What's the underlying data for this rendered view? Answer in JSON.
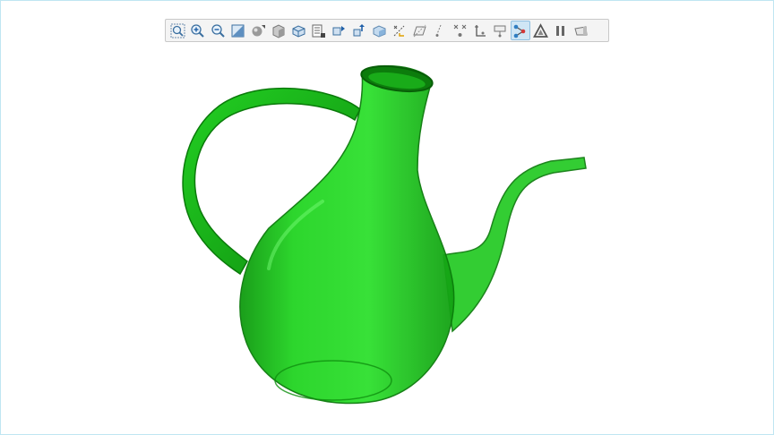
{
  "viewer": {
    "background_color": "#ffffff",
    "border_color": "#bfe6f2",
    "model_color": "#1ecc1e"
  },
  "toolbar": {
    "tools": [
      {
        "icon": "zoom-fit-icon",
        "active": false
      },
      {
        "icon": "zoom-in-icon",
        "active": false
      },
      {
        "icon": "zoom-out-icon",
        "active": false
      },
      {
        "icon": "section-plane-icon",
        "active": false
      },
      {
        "icon": "shading-icon",
        "active": false
      },
      {
        "icon": "box-view-icon",
        "active": false
      },
      {
        "icon": "named-views-icon",
        "active": false
      },
      {
        "icon": "model-tree-icon",
        "active": false
      },
      {
        "icon": "move-part-icon",
        "active": false
      },
      {
        "icon": "explode-icon",
        "active": false
      },
      {
        "icon": "transparency-icon",
        "active": false
      },
      {
        "icon": "measure-distance-icon",
        "active": false
      },
      {
        "icon": "measure-plane-icon",
        "active": false
      },
      {
        "icon": "measure-line-icon",
        "active": false
      },
      {
        "icon": "measure-point-icon",
        "active": false
      },
      {
        "icon": "measure-angle-icon",
        "active": false
      },
      {
        "icon": "measure-radius-icon",
        "active": false
      },
      {
        "icon": "graph-nodes-icon",
        "active": true
      },
      {
        "icon": "triangle-warning-icon",
        "active": false
      },
      {
        "icon": "pause-icon",
        "active": false
      },
      {
        "icon": "shape-icon",
        "active": false
      }
    ]
  }
}
